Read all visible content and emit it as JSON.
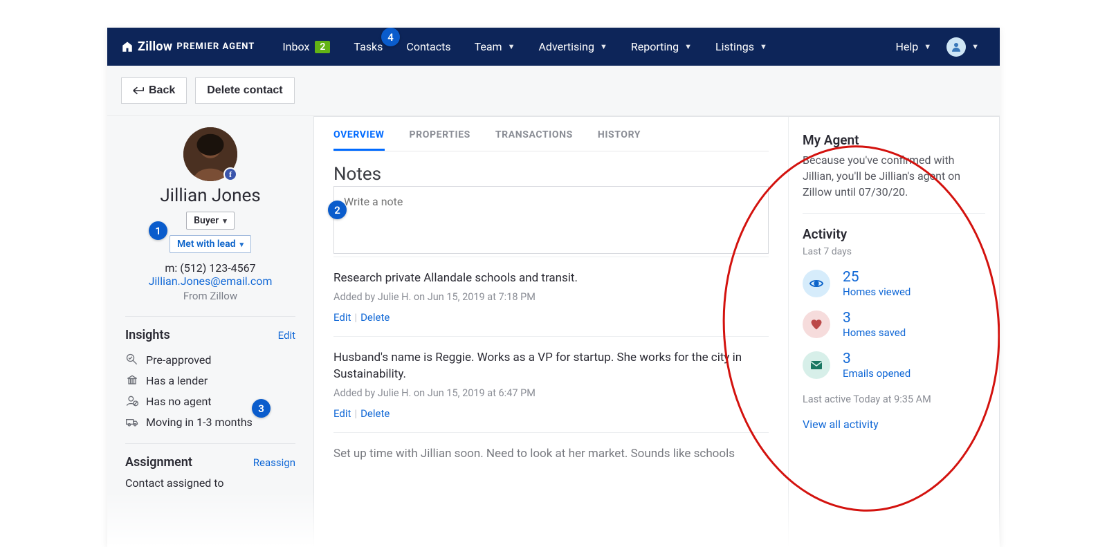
{
  "nav": {
    "brand1": "Zillow",
    "brand2": "PREMIER AGENT",
    "inbox_label": "Inbox",
    "inbox_count": "2",
    "tasks": "Tasks",
    "contacts": "Contacts",
    "team": "Team",
    "advertising": "Advertising",
    "reporting": "Reporting",
    "listings": "Listings",
    "help": "Help"
  },
  "actions": {
    "back": "Back",
    "delete": "Delete contact"
  },
  "profile": {
    "name": "Jillian Jones",
    "type_label": "Buyer",
    "status_label": "Met with lead",
    "phone": "m: (512) 123-4567",
    "email": "Jillian.Jones@email.com",
    "source": "From Zillow"
  },
  "insights": {
    "title": "Insights",
    "edit": "Edit",
    "items": [
      "Pre-approved",
      "Has a lender",
      "Has no agent",
      "Moving in 1-3 months"
    ]
  },
  "assignment": {
    "title": "Assignment",
    "reassign": "Reassign",
    "text": "Contact assigned to"
  },
  "tabs": [
    "OVERVIEW",
    "PROPERTIES",
    "TRANSACTIONS",
    "HISTORY"
  ],
  "notes": {
    "title": "Notes",
    "placeholder": "Write a note",
    "edit": "Edit",
    "delete": "Delete",
    "items": [
      {
        "text": "Research private Allandale schools and transit.",
        "meta": "Added by Julie H. on Jun 15, 2019 at 7:18 PM"
      },
      {
        "text": "Husband's name is Reggie. Works as a VP for startup. She works for the city in Sustainability.",
        "meta": "Added by Julie H. on Jun 15, 2019 at 6:47 PM"
      },
      {
        "text": "Set up time with Jillian soon. Need to look at her market. Sounds like schools",
        "meta": ""
      }
    ]
  },
  "myagent": {
    "title": "My Agent",
    "text": "Because you've confirmed with Jillian, you'll be Jillian's agent on Zillow until 07/30/20."
  },
  "activity": {
    "title": "Activity",
    "range": "Last 7 days",
    "rows": [
      {
        "num": "25",
        "label": "Homes viewed"
      },
      {
        "num": "3",
        "label": "Homes saved"
      },
      {
        "num": "3",
        "label": "Emails opened"
      }
    ],
    "last_active": "Last active Today at 9:35 AM",
    "view_all": "View all activity"
  },
  "markers": {
    "m1": "1",
    "m2": "2",
    "m3": "3",
    "m4": "4"
  }
}
